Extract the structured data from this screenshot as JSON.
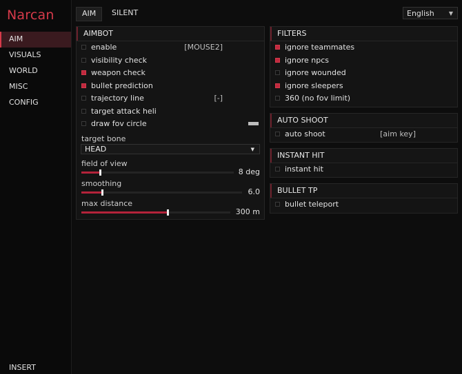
{
  "app": {
    "title": "Narcan",
    "footer_key": "INSERT"
  },
  "sidebar": {
    "items": [
      {
        "label": "AIM",
        "active": true
      },
      {
        "label": "VISUALS"
      },
      {
        "label": "WORLD"
      },
      {
        "label": "MISC"
      },
      {
        "label": "CONFIG"
      }
    ]
  },
  "tabs": [
    {
      "label": "AIM",
      "active": true
    },
    {
      "label": "SILENT"
    }
  ],
  "language": {
    "selected": "English"
  },
  "colors": {
    "accent": "#d63a4a",
    "checkbox_on": "#c0283f",
    "slider_fill": "#b4233a"
  },
  "aimbot": {
    "title": "AIMBOT",
    "options": [
      {
        "label": "enable",
        "checked": false,
        "value": "[MOUSE2]"
      },
      {
        "label": "visibility check",
        "checked": false
      },
      {
        "label": "weapon check",
        "checked": true
      },
      {
        "label": "bullet prediction",
        "checked": true
      },
      {
        "label": "trajectory line",
        "checked": false,
        "value": "[-]"
      },
      {
        "label": "target attack heli",
        "checked": false
      },
      {
        "label": "draw fov circle",
        "checked": false,
        "color": "#bdbdbd"
      }
    ],
    "target_bone": {
      "label": "target bone",
      "value": "HEAD"
    },
    "sliders": [
      {
        "label": "field of view",
        "value": "8 deg",
        "fraction": 0.12
      },
      {
        "label": "smoothing",
        "value": "6.0",
        "fraction": 0.13
      },
      {
        "label": "max distance",
        "value": "300 m",
        "fraction": 0.58
      }
    ]
  },
  "filters": {
    "title": "FILTERS",
    "options": [
      {
        "label": "ignore teammates",
        "checked": true
      },
      {
        "label": "ignore npcs",
        "checked": true
      },
      {
        "label": "ignore wounded",
        "checked": false
      },
      {
        "label": "ignore sleepers",
        "checked": true
      },
      {
        "label": "360 (no fov limit)",
        "checked": false
      }
    ]
  },
  "auto_shoot": {
    "title": "AUTO SHOOT",
    "option": {
      "label": "auto shoot",
      "checked": false,
      "value": "[aim key]"
    }
  },
  "instant_hit": {
    "title": "INSTANT HIT",
    "option": {
      "label": "instant hit",
      "checked": false
    }
  },
  "bullet_tp": {
    "title": "BULLET TP",
    "option": {
      "label": "bullet teleport",
      "checked": false
    }
  }
}
